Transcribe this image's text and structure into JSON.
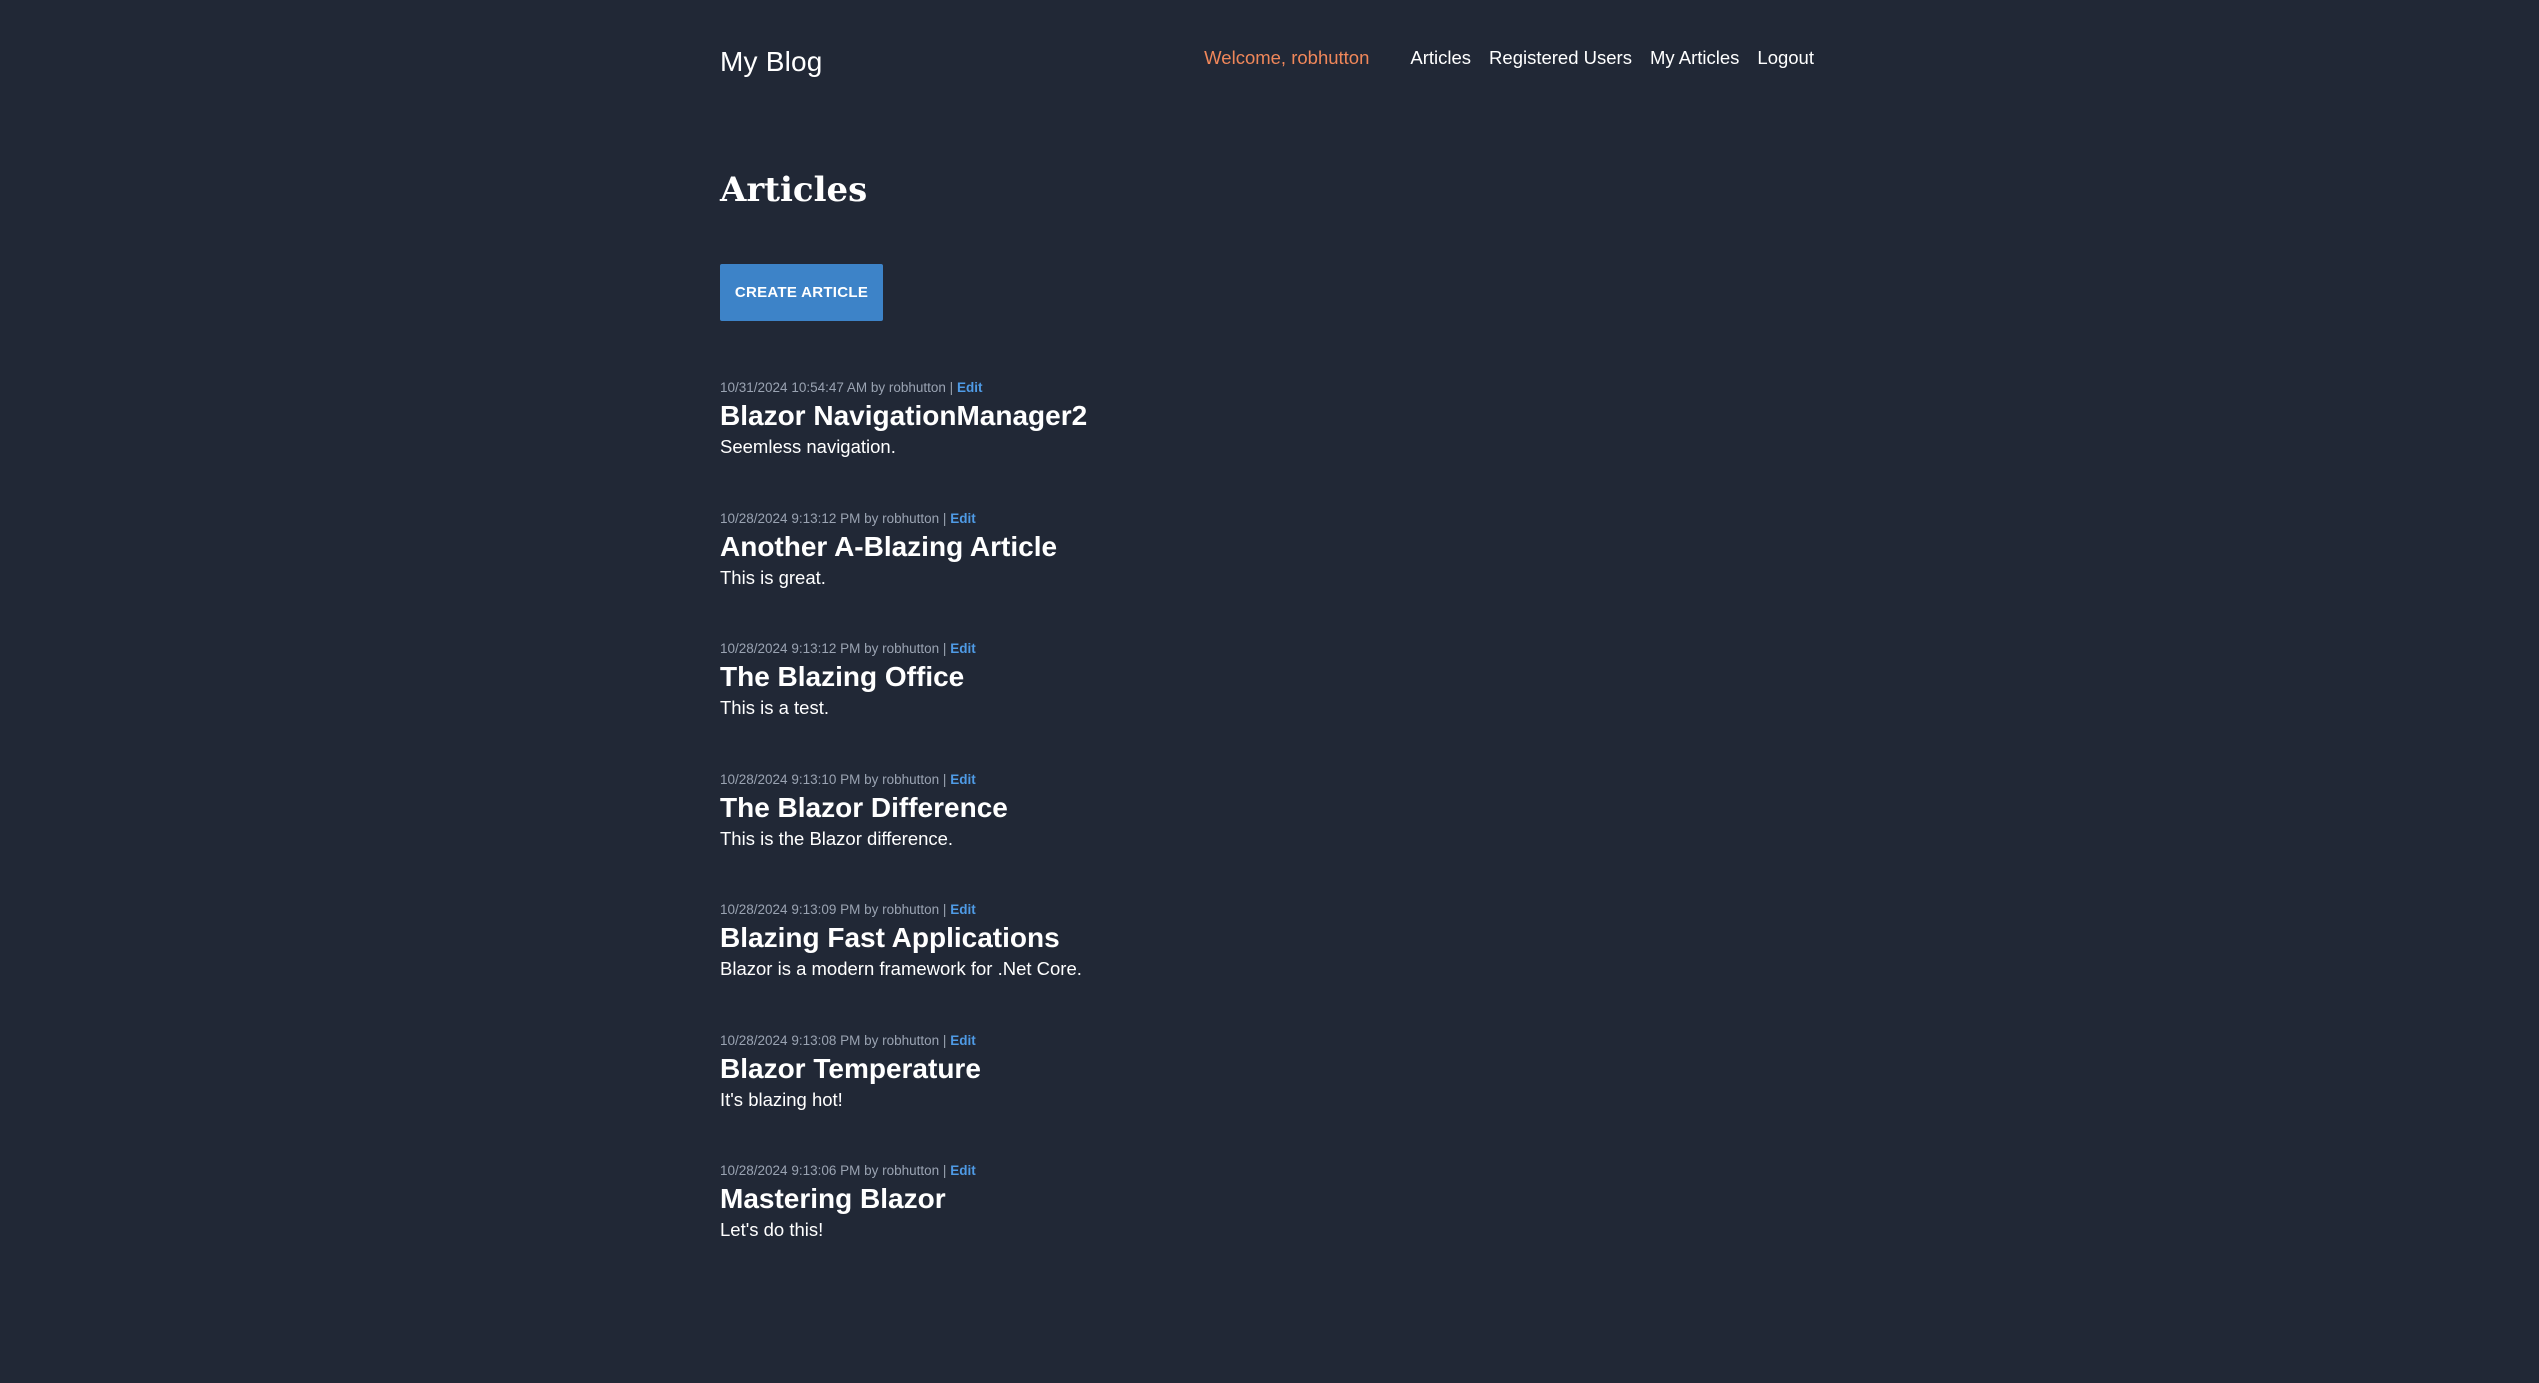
{
  "header": {
    "site_title": "My Blog",
    "welcome": "Welcome, robhutton",
    "nav": [
      "Articles",
      "Registered Users",
      "My Articles",
      "Logout"
    ]
  },
  "main": {
    "page_title": "Articles",
    "create_button_label": "CREATE ARTICLE",
    "edit_label": "Edit",
    "articles": [
      {
        "meta": "10/31/2024 10:54:47 AM by robhutton | ",
        "title": "Blazor NavigationManager2",
        "summary": "Seemless navigation."
      },
      {
        "meta": "10/28/2024 9:13:12 PM by robhutton | ",
        "title": "Another A-Blazing Article",
        "summary": "This is great."
      },
      {
        "meta": "10/28/2024 9:13:12 PM by robhutton | ",
        "title": "The Blazing Office",
        "summary": "This is a test."
      },
      {
        "meta": "10/28/2024 9:13:10 PM by robhutton | ",
        "title": "The Blazor Difference",
        "summary": "This is the Blazor difference."
      },
      {
        "meta": "10/28/2024 9:13:09 PM by robhutton | ",
        "title": "Blazing Fast Applications",
        "summary": "Blazor is a modern framework for .Net Core."
      },
      {
        "meta": "10/28/2024 9:13:08 PM by robhutton | ",
        "title": "Blazor Temperature",
        "summary": "It's blazing hot!"
      },
      {
        "meta": "10/28/2024 9:13:06 PM by robhutton | ",
        "title": "Mastering Blazor",
        "summary": "Let's do this!"
      }
    ]
  },
  "colors": {
    "background": "#212836",
    "welcome": "#f0875a",
    "button": "#3d83c8",
    "edit_link": "#4f9be6"
  }
}
